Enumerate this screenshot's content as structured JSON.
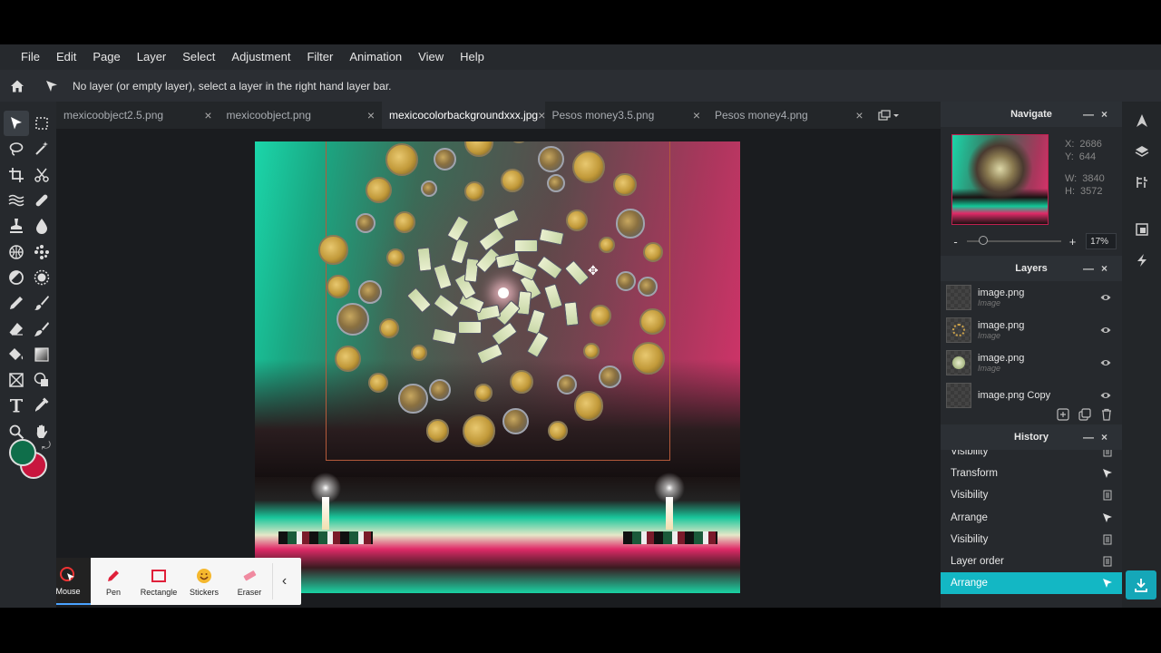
{
  "menu": [
    "File",
    "Edit",
    "Page",
    "Layer",
    "Select",
    "Adjustment",
    "Filter",
    "Animation",
    "View",
    "Help"
  ],
  "options": {
    "message": "No layer (or empty layer), select a layer in the right hand layer bar."
  },
  "tabs": [
    {
      "label": "mexicoobject2.5.png",
      "close": "×"
    },
    {
      "label": "mexicoobject.png",
      "close": "×"
    },
    {
      "label": "mexicocolorbackgroundxxx.jpg",
      "close": "×"
    },
    {
      "label": "Pesos money3.5.png",
      "close": "×"
    },
    {
      "label": "Pesos money4.png",
      "close": "×"
    }
  ],
  "colors": {
    "foreground": "#0f6e4a",
    "background": "#c8163e",
    "accent": "#13b7c4"
  },
  "navigate": {
    "title": "Navigate",
    "x_label": "X:",
    "x": "2686",
    "y_label": "Y:",
    "y": "644",
    "w_label": "W:",
    "w": "3840",
    "h_label": "H:",
    "h": "3572",
    "zoom_minus": "-",
    "zoom_plus": "+",
    "zoom": "17%",
    "zoom_fraction": 0.17
  },
  "layers": {
    "title": "Layers",
    "items": [
      {
        "name": "image.png",
        "type": "Image"
      },
      {
        "name": "image.png",
        "type": "Image"
      },
      {
        "name": "image.png",
        "type": "Image"
      },
      {
        "name": "image.png Copy",
        "type": ""
      }
    ]
  },
  "history": {
    "title": "History",
    "items": [
      "Visibility",
      "Transform",
      "Visibility",
      "Arrange",
      "Visibility",
      "Layer order",
      "Arrange"
    ]
  },
  "recorder": {
    "tools": [
      {
        "label": "Mouse",
        "icon": "mouse-icon"
      },
      {
        "label": "Pen",
        "icon": "pen-icon"
      },
      {
        "label": "Rectangle",
        "icon": "rectangle-icon"
      },
      {
        "label": "Stickers",
        "icon": "sticker-icon"
      },
      {
        "label": "Eraser",
        "icon": "eraser-icon"
      }
    ]
  }
}
